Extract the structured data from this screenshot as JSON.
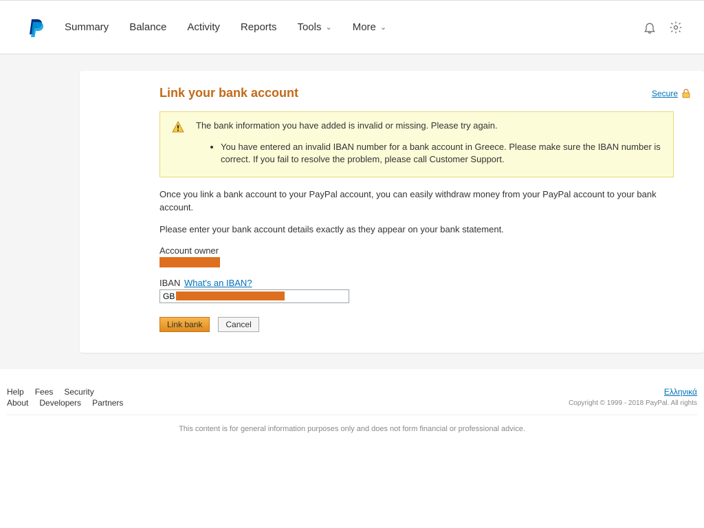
{
  "nav": {
    "summary": "Summary",
    "balance": "Balance",
    "activity": "Activity",
    "reports": "Reports",
    "tools": "Tools",
    "more": "More"
  },
  "page": {
    "title": "Link your bank account",
    "secure": "Secure",
    "alert_head": "The bank information you have added is invalid or missing. Please try again.",
    "alert_item": "You have entered an invalid IBAN number for a bank account in Greece. Please make sure the IBAN number is correct. If you fail to resolve the problem, please call Customer Support.",
    "desc1": "Once you link a bank account to your PayPal account, you can easily withdraw money from your PayPal account to your bank account.",
    "desc2": "Please enter your bank account details exactly as they appear on your bank statement.",
    "owner_label": "Account owner",
    "iban_label": "IBAN",
    "whats_iban": "What's an IBAN?",
    "iban_value": "GB",
    "link_btn": "Link bank",
    "cancel_btn": "Cancel"
  },
  "footer": {
    "help": "Help",
    "fees": "Fees",
    "security": "Security",
    "about": "About",
    "developers": "Developers",
    "partners": "Partners",
    "locale": "Ελληνικά",
    "copyright": "Copyright © 1999 - 2018 PayPal. All rights",
    "disclaimer": "This content is for general information purposes only and does not form financial or professional advice."
  }
}
